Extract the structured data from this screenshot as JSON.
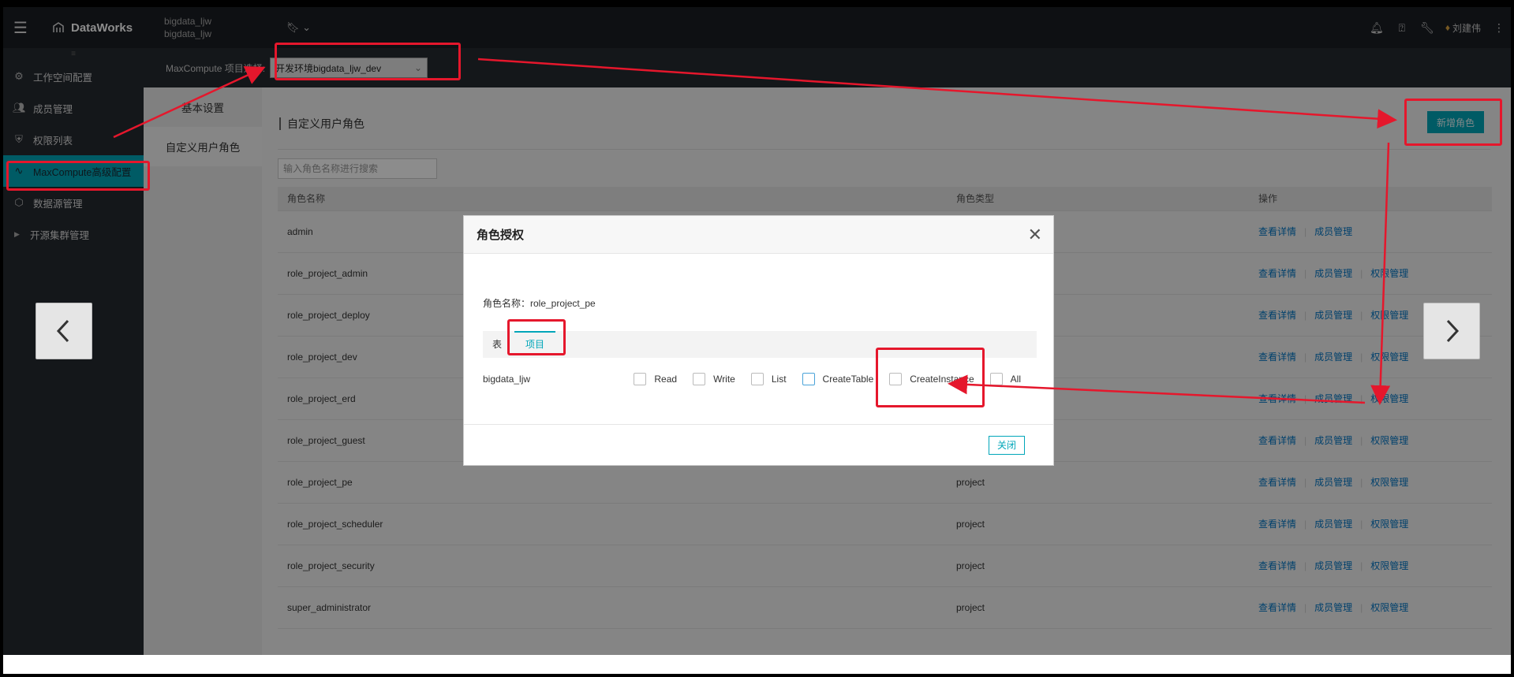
{
  "topbar": {
    "app_name": "DataWorks",
    "workspace_line1": "bigdata_ljw",
    "workspace_line2": "bigdata_ljw",
    "user_name": "刘建伟"
  },
  "subbar": {
    "project_label": "MaxCompute 项目选择:",
    "project_value": "开发环境bigdata_ljw_dev"
  },
  "sidebar": {
    "items": [
      {
        "label": "工作空间配置",
        "icon": "gear-icon"
      },
      {
        "label": "成员管理",
        "icon": "users-icon"
      },
      {
        "label": "权限列表",
        "icon": "shield-icon"
      },
      {
        "label": "MaxCompute高级配置",
        "icon": "wave-icon"
      },
      {
        "label": "数据源管理",
        "icon": "datasource-icon"
      },
      {
        "label": "开源集群管理",
        "icon": "caret-right-icon"
      }
    ]
  },
  "settings_nav": {
    "items": [
      {
        "label": "基本设置"
      },
      {
        "label": "自定义用户角色"
      }
    ]
  },
  "content": {
    "title": "自定义用户角色",
    "add_role_label": "新增角色",
    "search_placeholder": "输入角色名称进行搜索",
    "columns": [
      "角色名称",
      "角色类型",
      "操作"
    ],
    "op_view": "查看详情",
    "op_members": "成员管理",
    "op_perms": "权限管理",
    "rows": [
      {
        "name": "admin",
        "type": ""
      },
      {
        "name": "role_project_admin",
        "type": ""
      },
      {
        "name": "role_project_deploy",
        "type": ""
      },
      {
        "name": "role_project_dev",
        "type": ""
      },
      {
        "name": "role_project_erd",
        "type": ""
      },
      {
        "name": "role_project_guest",
        "type": ""
      },
      {
        "name": "role_project_pe",
        "type": "project"
      },
      {
        "name": "role_project_scheduler",
        "type": "project"
      },
      {
        "name": "role_project_security",
        "type": "project"
      },
      {
        "name": "super_administrator",
        "type": "project"
      }
    ]
  },
  "dialog": {
    "title": "角色授权",
    "role_name_text": "角色名称：role_project_pe",
    "tabs": [
      "表",
      "项目"
    ],
    "project_name": "bigdata_ljw",
    "permissions": [
      "Read",
      "Write",
      "List",
      "CreateTable",
      "CreateInstance",
      "All"
    ],
    "close_label": "关闭"
  },
  "colors": {
    "accent": "#00a6b9",
    "annotation": "#e5172c",
    "link": "#0075c5"
  }
}
